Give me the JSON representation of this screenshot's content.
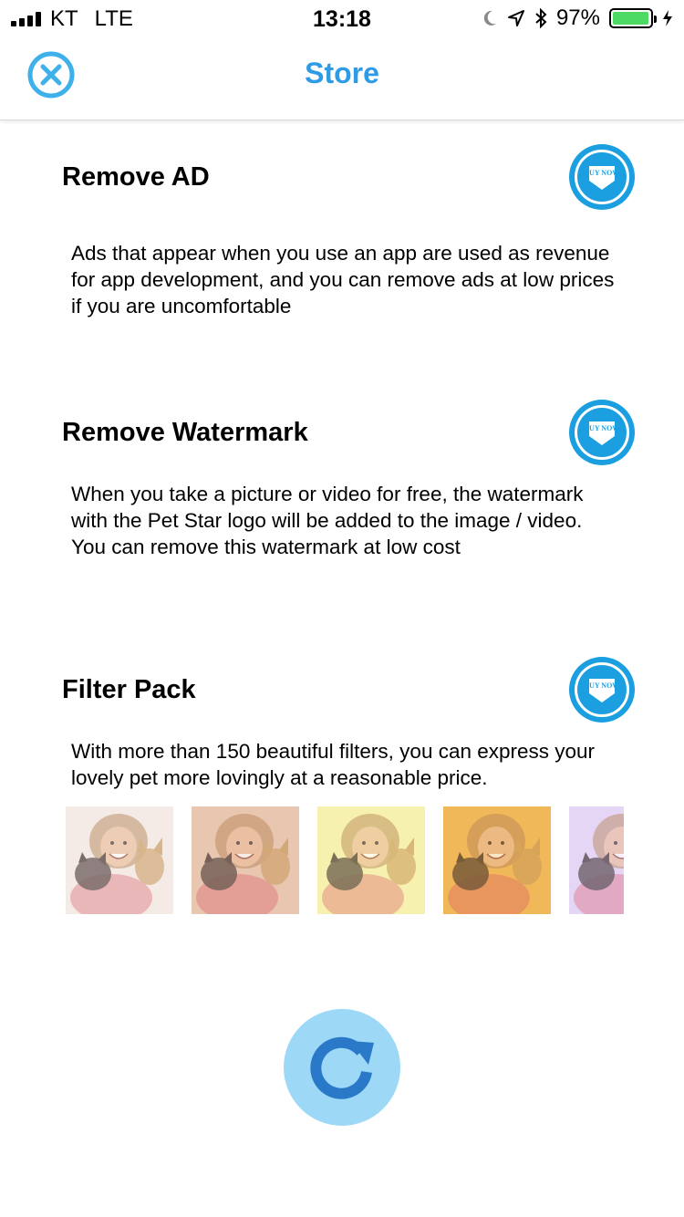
{
  "status_bar": {
    "carrier": "KT",
    "network": "LTE",
    "time": "13:18",
    "battery_percent_label": "97%",
    "battery_level": 0.97
  },
  "nav": {
    "title": "Store",
    "close_icon": "close-circle-icon"
  },
  "sections": [
    {
      "title": "Remove AD",
      "description": "Ads that appear when you use an app are used as revenue for app development, and you can remove ads at low prices if you are uncomfortable",
      "buy_label": "BUY NOW"
    },
    {
      "title": "Remove Watermark",
      "description": "When you take a picture or video for free, the watermark with the Pet Star logo will be added to the image / video. You can remove this watermark at low cost",
      "buy_label": "BUY NOW"
    },
    {
      "title": "Filter Pack",
      "description": "With more than 150 beautiful filters, you can express your lovely pet more lovingly at a reasonable price.",
      "buy_label": "BUY NOW"
    }
  ],
  "filter_previews": [
    {
      "name": "original",
      "tint": "#f4ece6"
    },
    {
      "name": "warm",
      "tint": "#e9c7b0"
    },
    {
      "name": "yellow",
      "tint": "#f6f2b0"
    },
    {
      "name": "amber",
      "tint": "#f2b85a"
    },
    {
      "name": "violet",
      "tint": "#e6d6f6"
    }
  ],
  "colors": {
    "accent": "#2e9be6",
    "buy_button": "#1b9fe0",
    "refresh_bg": "#9dd9f6",
    "refresh_arrow": "#2a78c8"
  },
  "refresh_icon": "refresh-icon"
}
